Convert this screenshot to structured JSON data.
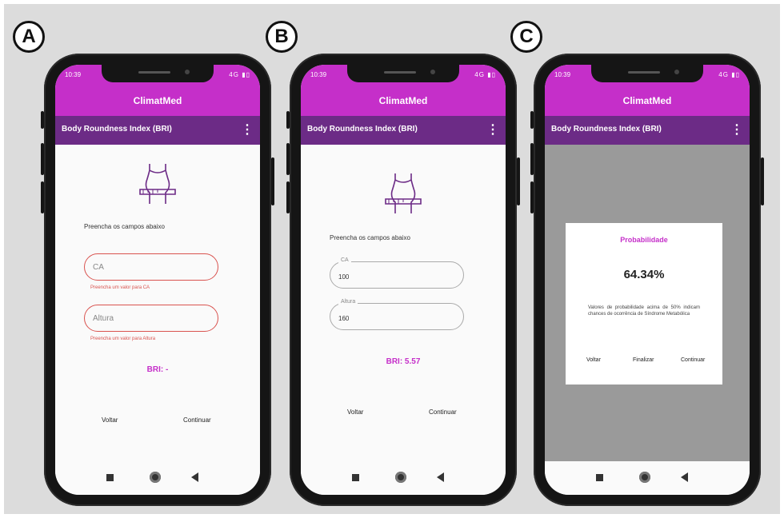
{
  "panel_labels": [
    "A",
    "B",
    "C"
  ],
  "status": {
    "time": "10:39",
    "icons": "4G ▮▯"
  },
  "app": {
    "title": "ClimatMed",
    "screen_title": "Body Roundness Index (BRI)",
    "more": "⋮"
  },
  "icons": {
    "torso": "torso-measure-icon",
    "more": "more-vert-icon",
    "home": "nav-home-icon",
    "recents": "nav-recents-icon",
    "back": "nav-back-icon"
  },
  "colors": {
    "appbar": "#c52fc9",
    "toolbar": "#6c2b86",
    "accent": "#c52fc9",
    "error": "#d9534f",
    "overlay": "#9a9a9a"
  },
  "screen_a": {
    "instruction": "Preencha os campos abaixo",
    "field_ca": {
      "placeholder": "CA",
      "error": "Preencha um valor para CA"
    },
    "field_altura": {
      "placeholder": "Altura",
      "error": "Preencha um valor para Altura"
    },
    "bri": "BRI: -",
    "back": "Voltar",
    "continue": "Continuar"
  },
  "screen_b": {
    "instruction": "Preencha os campos abaixo",
    "field_ca": {
      "label": "CA",
      "value": "100"
    },
    "field_altura": {
      "label": "Altura",
      "value": "160"
    },
    "bri": "BRI: 5.57",
    "back": "Voltar",
    "continue": "Continuar"
  },
  "screen_c": {
    "dialog_title": "Probabilidade",
    "dialog_value": "64.34%",
    "dialog_message": "Valores de probabilidade acima de 50% indicam chances de ocorrência de Síndrome Metabólica",
    "back": "Voltar",
    "finish": "Finalizar",
    "continue": "Continuar"
  }
}
